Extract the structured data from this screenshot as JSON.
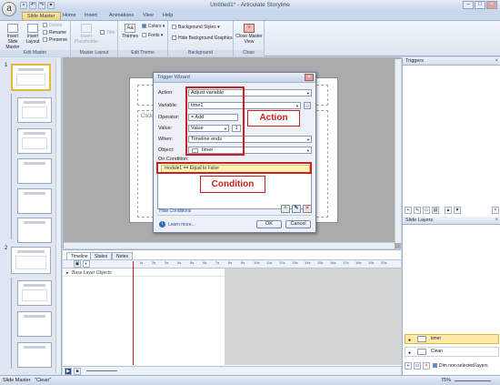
{
  "window": {
    "title": "Untitled1* - Articulate Storyline",
    "app_orb": "a",
    "controls": [
      "–",
      "□",
      "×"
    ],
    "quick_access": [
      "save-icon",
      "undo-icon",
      "redo-icon",
      "dropdown-icon"
    ]
  },
  "tabs": [
    "Slide Master",
    "Home",
    "Insert",
    "Animations",
    "View",
    "Help"
  ],
  "ribbon": {
    "edit_master": {
      "label": "Edit Master",
      "insert_slide_master": "Insert Slide Master",
      "insert_layout": "Insert Layout",
      "delete": "Delete",
      "rename": "Rename",
      "preserve": "Preserve"
    },
    "master_layout": {
      "label": "Master Layout",
      "insert_placeholder": "Insert Placeholder",
      "title": "Title"
    },
    "edit_theme": {
      "label": "Edit Theme",
      "themes": "Themes",
      "colors": "Colors",
      "fonts": "Fonts"
    },
    "background": {
      "label": "Background",
      "background_styles": "Background Styles",
      "hide_background_graphics": "Hide Background Graphics"
    },
    "close": {
      "label": "Close",
      "close_master_view": "Close Master View"
    }
  },
  "slide_panel": {
    "group_numbers": [
      "1",
      "2"
    ]
  },
  "slide": {
    "body_placeholder": "Click t"
  },
  "dialog": {
    "title": "Trigger Wizard",
    "action_label": "Action:",
    "action_value": "Adjust variable",
    "variable_label": "Variable:",
    "variable_value": "time1",
    "operator_label": "Operator:",
    "operator_value": "= Add",
    "value_label": "Value:",
    "value_type": "Value",
    "value_number": "1",
    "when_label": "When:",
    "when_value": "Timeline ends",
    "object_label": "Object:",
    "object_value": "timer",
    "on_condition_label": "On Condition:",
    "condition_row": "module1 == Equal to False",
    "hide_conditions": "Hide Conditions",
    "learn_more": "Learn more...",
    "ok": "OK",
    "cancel": "Cancel"
  },
  "annotations": {
    "action": "Action",
    "condition": "Condition"
  },
  "triggers_panel": {
    "title": "Triggers"
  },
  "layers_panel": {
    "title": "Slide Layers",
    "layers": [
      {
        "name": "timer",
        "selected": true
      },
      {
        "name": "Clean",
        "selected": false
      }
    ],
    "dim_label": "Dim non-selected layers"
  },
  "timeline": {
    "tabs": [
      "Timeline",
      "States",
      "Notes"
    ],
    "row_label": "Base Layer Objects",
    "ticks": [
      "1s",
      "2s",
      "3s",
      "4s",
      "5s",
      "6s",
      "7s",
      "8s",
      "9s",
      "10s",
      "11s",
      "12s",
      "13s",
      "14s",
      "15s",
      "16s",
      "17s",
      "18s",
      "19s",
      "20s"
    ]
  },
  "status": {
    "left": "Slide Master",
    "theme": "\"Clean\"",
    "zoom": "75%"
  },
  "colors": {
    "annotation_red": "#cc1f1f",
    "selected_yellow": "#ffe9a8"
  }
}
